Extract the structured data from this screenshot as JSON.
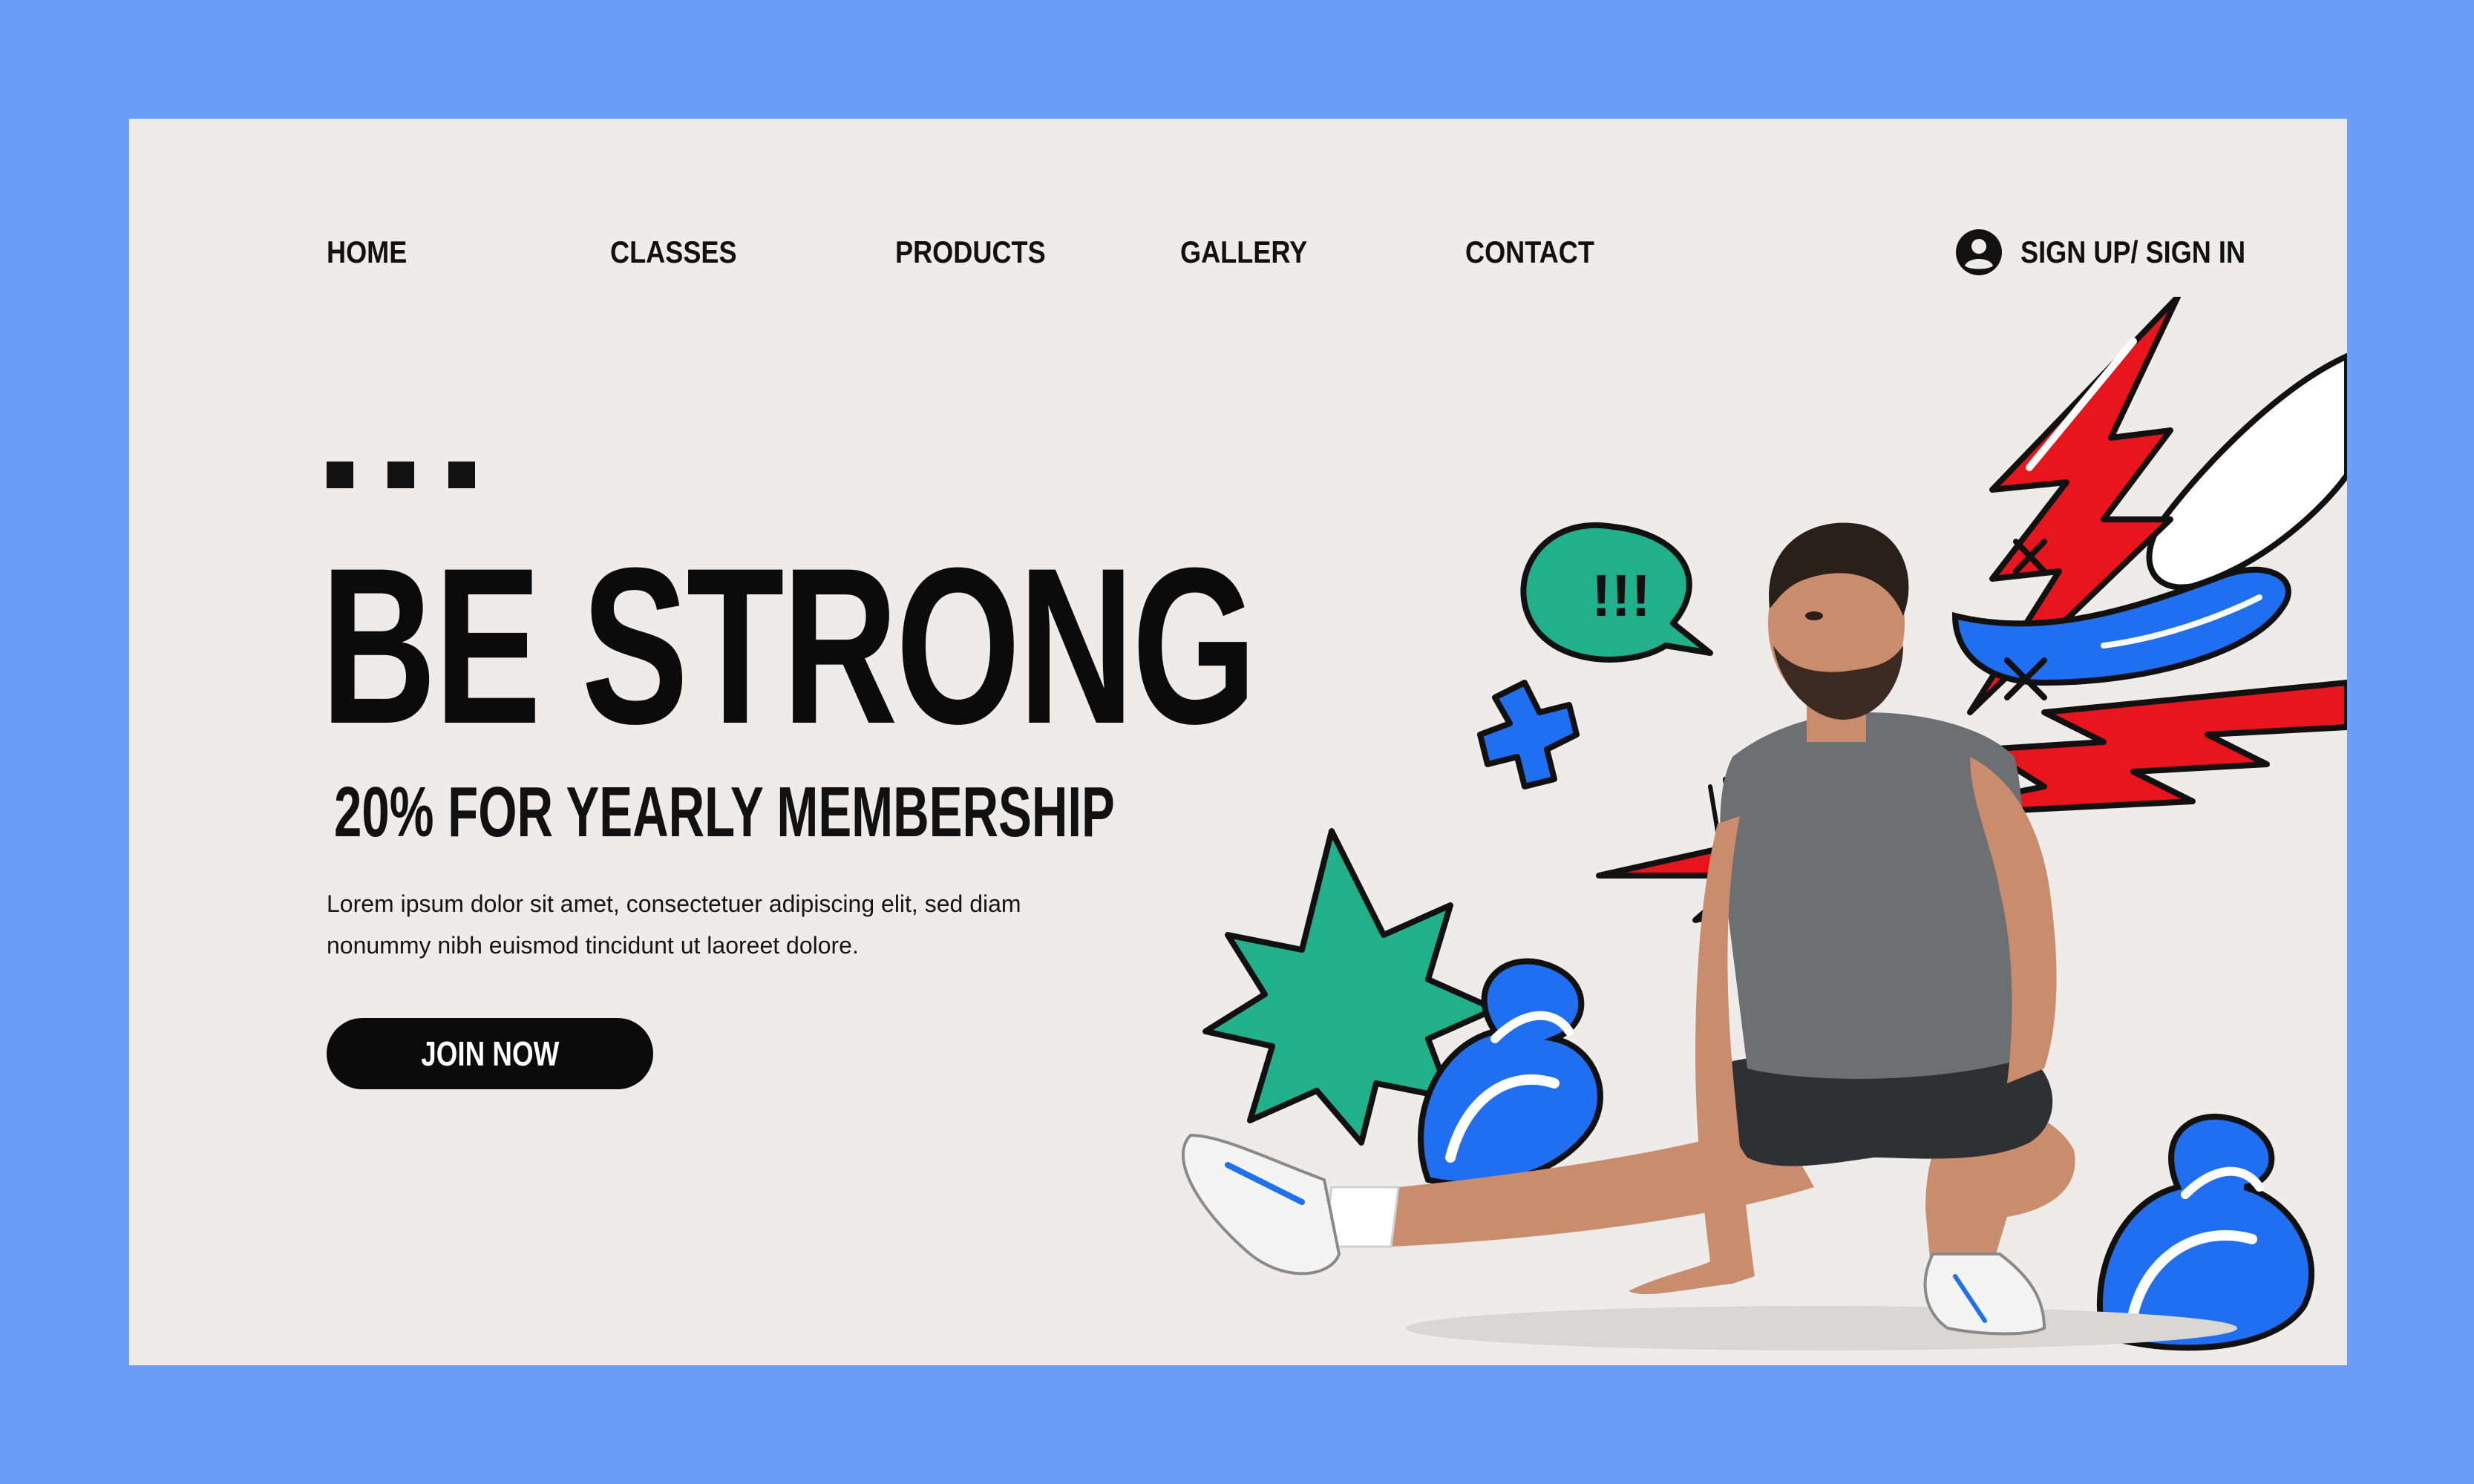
{
  "nav": {
    "items": [
      {
        "label": "HOME"
      },
      {
        "label": "CLASSES"
      },
      {
        "label": "PRODUCTS"
      },
      {
        "label": "GALLERY"
      },
      {
        "label": "CONTACT"
      }
    ],
    "account_label": "SIGN UP/ SIGN IN",
    "account_icon": "user-circle-icon"
  },
  "hero": {
    "headline": "BE STRONG",
    "subheadline": "20% FOR YEARLY MEMBERSHIP",
    "body_line1": "Lorem ipsum dolor sit amet, consectetuer adipiscing elit, sed diam",
    "body_line2": "nonummy nibh euismod tincidunt ut laoreet dolore.",
    "cta_label": "JOIN NOW",
    "exclaim_text": "!!!"
  },
  "colors": {
    "frame": "#6b9ef9",
    "background": "#edecea",
    "text": "#111111",
    "accent_red": "#e9151c",
    "accent_blue": "#1f6ff0",
    "accent_green": "#21b08c"
  }
}
